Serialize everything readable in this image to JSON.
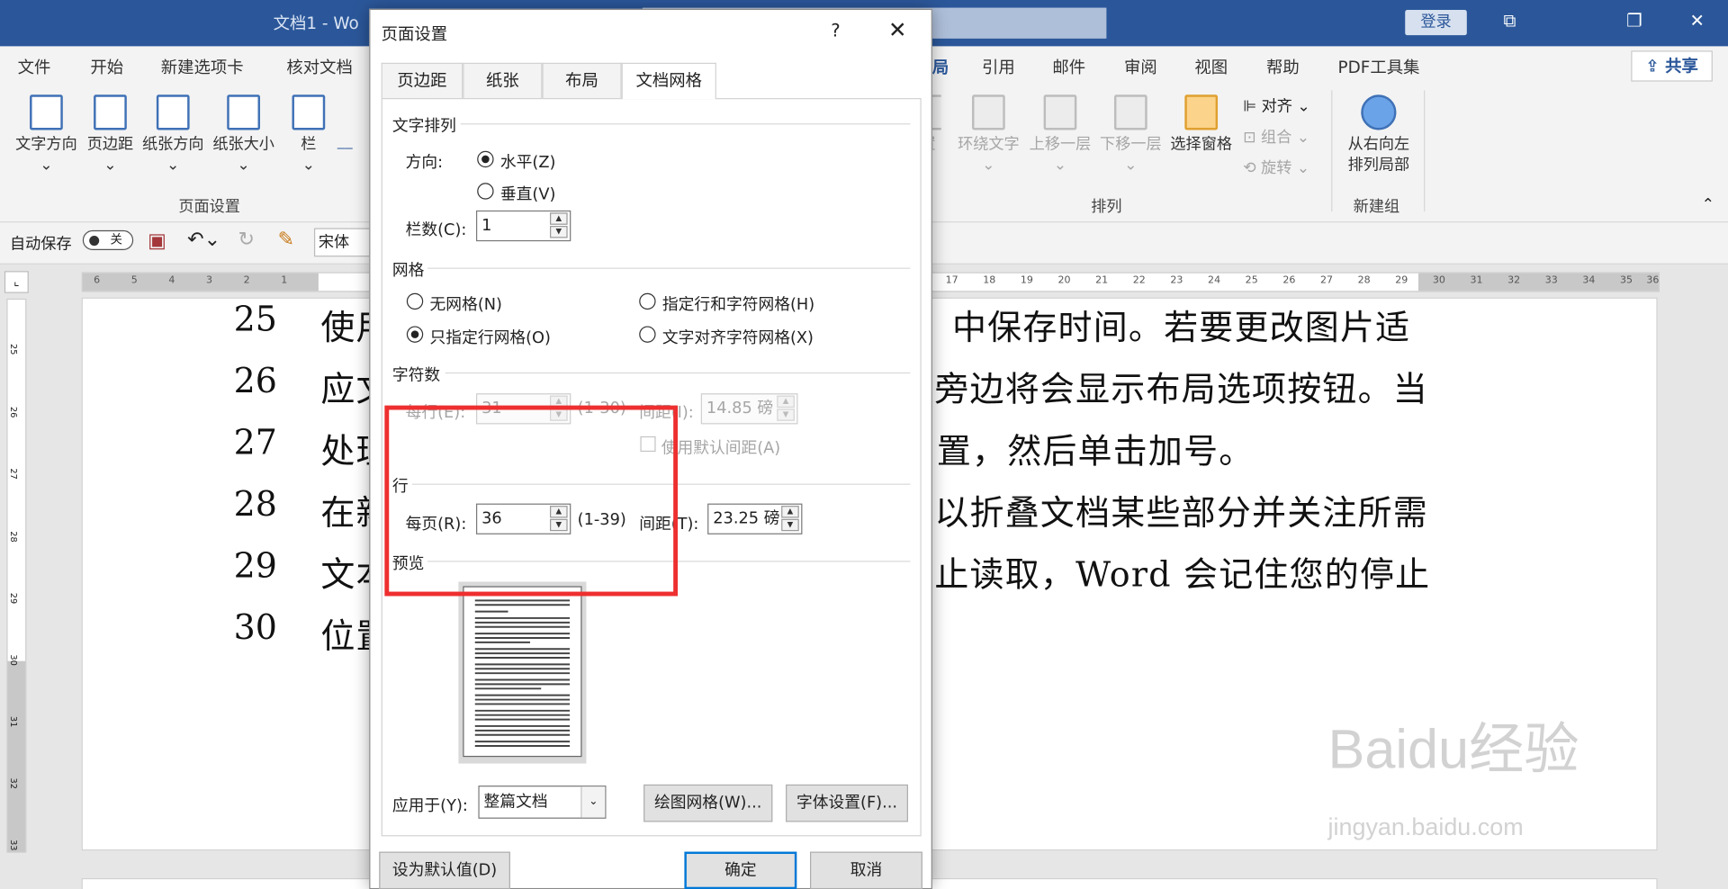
{
  "window": {
    "title": "文档1 - Wo",
    "login": "登录",
    "share": "共享"
  },
  "ribbon": {
    "tabs": [
      "文件",
      "开始",
      "新建选项卡",
      "核对文档",
      "局",
      "引用",
      "邮件",
      "审阅",
      "视图",
      "帮助",
      "PDF工具集"
    ],
    "page_setup": {
      "label": "页面设置",
      "buttons": [
        "文字方向",
        "页边距",
        "纸张方向",
        "纸张大小",
        "栏"
      ]
    },
    "arrange": {
      "label": "排列",
      "buttons": [
        "置",
        "环绕文字",
        "上移一层",
        "下移一层",
        "选择窗格"
      ],
      "small": [
        "对齐",
        "组合",
        "旋转"
      ]
    },
    "new_group": {
      "label": "新建组",
      "button_line1": "从右向左",
      "button_line2": "排列局部"
    }
  },
  "qat": {
    "autosave": "自动保存",
    "toggle": "关",
    "font": "宋体"
  },
  "ruler": {
    "h_left": [
      "6",
      "5",
      "4",
      "3",
      "2",
      "1"
    ],
    "h_right": [
      "17",
      "18",
      "19",
      "20",
      "21",
      "22",
      "23",
      "24",
      "25",
      "26",
      "27",
      "28",
      "29",
      "30",
      "31",
      "32",
      "33",
      "34",
      "35",
      "36"
    ],
    "v": [
      "25",
      "26",
      "27",
      "28",
      "29",
      "30",
      "31",
      "32",
      "33"
    ]
  },
  "doc_lines": [
    {
      "num": "25",
      "left": "使用",
      "right": "中保存时间。若要更改图片适"
    },
    {
      "num": "26",
      "left": "应文",
      "right": "旁边将会显示布局选项按钮。当"
    },
    {
      "num": "27",
      "left": "处理",
      "right": "置，然后单击加号。"
    },
    {
      "num": "28",
      "left": "在新",
      "right": "以折叠文档某些部分并关注所需"
    },
    {
      "num": "29",
      "left": "文本",
      "right": "止读取，Word 会记住您的停止"
    },
    {
      "num": "30",
      "left": "位置",
      "right": ""
    }
  ],
  "dialog": {
    "title": "页面设置",
    "help": "?",
    "close": "✕",
    "tabs": [
      "页边距",
      "纸张",
      "布局",
      "文档网格"
    ],
    "text_layout": {
      "label": "文字排列",
      "direction_label": "方向:",
      "horizontal": "水平(Z)",
      "vertical": "垂直(V)",
      "columns_label": "栏数(C):",
      "columns_value": "1"
    },
    "grid": {
      "label": "网格",
      "none": "无网格(N)",
      "lines_and_chars": "指定行和字符网格(H)",
      "lines_only": "只指定行网格(O)",
      "align_chars": "文字对齐字符网格(X)"
    },
    "chars": {
      "label": "字符数",
      "per_line_label": "每行(E):",
      "per_line_value": "31",
      "range": "(1-30)",
      "pitch_label": "间距(I):",
      "pitch_value": "14.85 磅",
      "default_pitch": "使用默认间距(A)"
    },
    "lines": {
      "label": "行",
      "per_page_label": "每页(R):",
      "per_page_value": "36",
      "range": "(1-39)",
      "pitch_label": "间距(T):",
      "pitch_value": "23.25 磅"
    },
    "preview_label": "预览",
    "apply_label": "应用于(Y):",
    "apply_value": "整篇文档",
    "draw_grid": "绘图网格(W)...",
    "font_settings": "字体设置(F)...",
    "set_default": "设为默认值(D)",
    "ok": "确定",
    "cancel": "取消"
  },
  "watermark": {
    "brand": "Baidu经验",
    "url": "jingyan.baidu.com"
  },
  "colors": {
    "titlebar": "#2b579a",
    "highlight": "#ee2f2f",
    "accent": "#0078d7"
  }
}
